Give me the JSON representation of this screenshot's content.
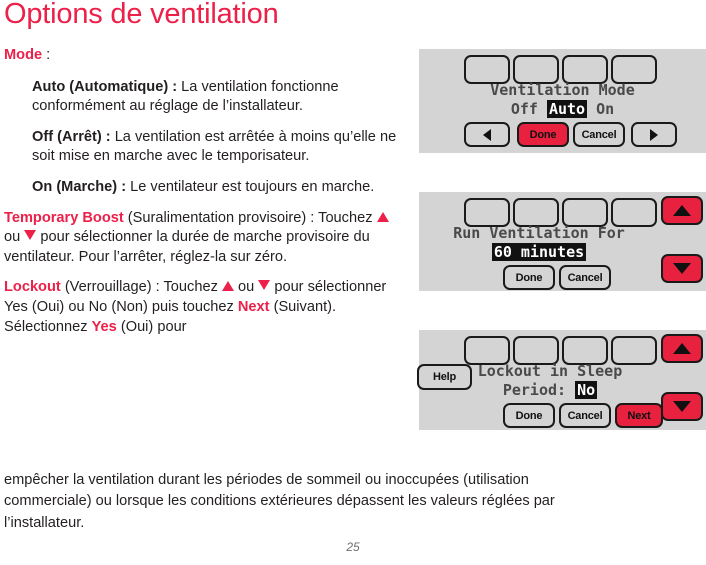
{
  "page": {
    "title": "Options de ventilation",
    "number": "25",
    "accent_color": "#ec2049",
    "text_color": "#231f20",
    "panel_background": "#d4d4d4"
  },
  "body": {
    "mode_label": "Mode",
    "mode_colon": " :",
    "items": [
      {
        "term": "Auto (Automatique) :",
        "text": " La ventilation fonctionne conformément au réglage de l’installateur."
      },
      {
        "term": "Off (Arrêt) :",
        "text": " La ventilation est arrêtée à moins qu’elle ne soit mise en marche avec le temporisateur."
      },
      {
        "term": "On (Marche) :",
        "text": " Le ventilateur est toujours en marche."
      }
    ],
    "temporary_boost": {
      "term": "Temporary Boost",
      "part1": " (Suralimentation provisoire) : Touchez ",
      "part2": " ou ",
      "part3": " pour sélectionner la durée de marche provisoire du ventilateur. Pour l’arrêter, réglez-la sur zéro."
    },
    "lockout": {
      "term": "Lockout",
      "part1": " (Verrouillage) : Touchez ",
      "part2": " ou ",
      "part3": " pour sélectionner Yes (Oui) ou No (Non) puis touchez ",
      "next_term": "Next",
      "part4": " (Suivant). Sélectionnez ",
      "yes_term": "Yes",
      "part5": " (Oui) pour"
    },
    "closing": "empêcher la ventilation durant les périodes de sommeil ou inoccupées (utilisation commerciale) ou lorsque les conditions extérieures dépassent les valeurs réglées par l’installateur."
  },
  "screens": [
    {
      "id": "ventilation-mode",
      "lcd_line1": "Ventilation Mode",
      "options": [
        "Off",
        "Auto",
        "On"
      ],
      "selected_option": "Auto",
      "buttons": [
        {
          "name": "left-arrow-button",
          "label": "",
          "icon": "triangle-left-icon",
          "style": "plain"
        },
        {
          "name": "done-button",
          "label": "Done",
          "style": "red"
        },
        {
          "name": "cancel-button",
          "label": "Cancel",
          "style": "plain"
        },
        {
          "name": "right-arrow-button",
          "label": "",
          "icon": "triangle-right-icon",
          "style": "plain"
        }
      ]
    },
    {
      "id": "run-ventilation-for",
      "lcd_line1": "Run Ventilation For",
      "value": "60 minutes",
      "buttons": [
        {
          "name": "done-button",
          "label": "Done",
          "style": "plain"
        },
        {
          "name": "cancel-button",
          "label": "Cancel",
          "style": "plain"
        }
      ],
      "side_buttons": [
        {
          "name": "up-arrow-button",
          "icon": "triangle-up-icon",
          "style": "red"
        },
        {
          "name": "down-arrow-button",
          "icon": "triangle-down-icon",
          "style": "red"
        }
      ]
    },
    {
      "id": "lockout-in-sleep-period",
      "lcd_line1": "Lockout in Sleep",
      "lcd_line2_prefix": "Period: ",
      "value": "No",
      "help_label": "Help",
      "buttons": [
        {
          "name": "done-button",
          "label": "Done",
          "style": "plain"
        },
        {
          "name": "cancel-button",
          "label": "Cancel",
          "style": "plain"
        },
        {
          "name": "next-button",
          "label": "Next",
          "style": "red"
        }
      ],
      "side_buttons": [
        {
          "name": "up-arrow-button",
          "icon": "triangle-up-icon",
          "style": "red"
        },
        {
          "name": "down-arrow-button",
          "icon": "triangle-down-icon",
          "style": "red"
        }
      ]
    }
  ]
}
